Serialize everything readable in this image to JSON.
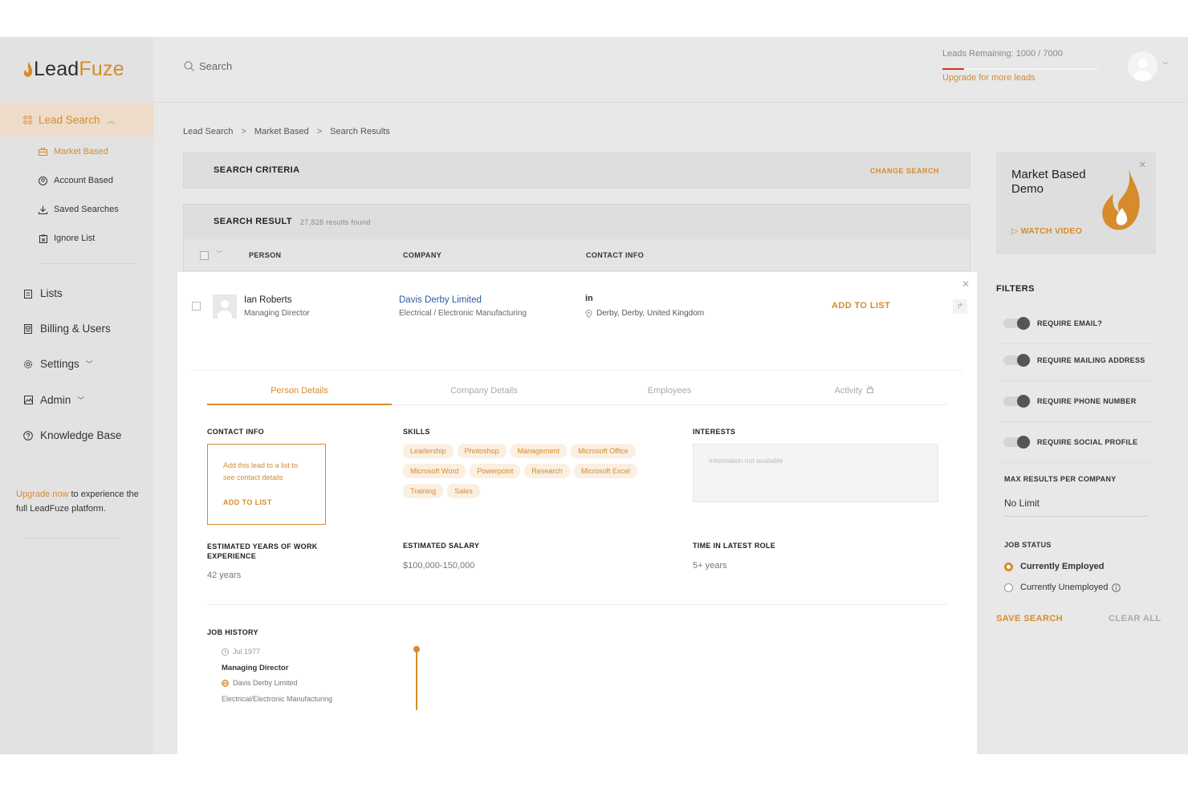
{
  "brand": {
    "lead": "Lead",
    "fuze": "Fuze",
    "accent": "#d68b2c"
  },
  "sidebar": {
    "section": {
      "label": "Lead Search",
      "icon": "grid-icon"
    },
    "subitems": [
      {
        "label": "Market Based",
        "icon": "briefcase-icon",
        "active": true
      },
      {
        "label": "Account Based",
        "icon": "user-circle-icon"
      },
      {
        "label": "Saved Searches",
        "icon": "download-icon"
      },
      {
        "label": "Ignore List",
        "icon": "clipboard-x-icon"
      }
    ],
    "items": [
      {
        "label": "Lists",
        "icon": "clipboard-icon"
      },
      {
        "label": "Billing & Users",
        "icon": "receipt-icon"
      },
      {
        "label": "Settings",
        "icon": "gear-icon"
      },
      {
        "label": "Admin",
        "icon": "image-icon"
      },
      {
        "label": "Knowledge Base",
        "icon": "question-icon"
      }
    ],
    "upgrade": {
      "link": "Upgrade now",
      "rest": " to experience the full LeadFuze platform."
    }
  },
  "header": {
    "search_placeholder": "Search",
    "leads_remaining": "Leads Remaining: 1000 / 7000",
    "leads_fraction": 0.14,
    "upgrade_link": "Upgrade for more leads"
  },
  "breadcrumb": [
    "Lead Search",
    ">",
    "Market Based",
    ">",
    "Search Results"
  ],
  "criteria": {
    "title": "SEARCH CRITERIA",
    "change": "CHANGE SEARCH"
  },
  "results": {
    "title": "SEARCH RESULT",
    "count": "27,828 results found",
    "columns": [
      "PERSON",
      "COMPANY",
      "CONTACT INFO"
    ]
  },
  "lead": {
    "name": "Ian Roberts",
    "title": "Managing Director",
    "company": "Davis Derby Limited",
    "industry": "Electrical / Electronic Manufacturing",
    "linkedin": "in",
    "location": "Derby, Derby, United Kingdom",
    "add_to_list": "ADD TO LIST",
    "tabs": [
      "Person Details",
      "Company Details",
      "Employees",
      "Activity"
    ],
    "contact_info": {
      "label": "CONTACT INFO",
      "message": "Add this lead to a list to see contact details",
      "button": "ADD TO LIST"
    },
    "skills_label": "SKILLS",
    "skills": [
      "Leadership",
      "Photoshop",
      "Management",
      "Microsoft Office",
      "Microsoft Word",
      "Powerpoint",
      "Research",
      "Microsoft Excel",
      "Training",
      "Sales"
    ],
    "interests_label": "INTERESTS",
    "interests_empty": "Information not available",
    "years_label": "ESTIMATED YEARS OF WORK EXPERIENCE",
    "years_value": "42 years",
    "salary_label": "ESTIMATED SALARY",
    "salary_value": "$100,000-150,000",
    "role_time_label": "TIME IN LATEST ROLE",
    "role_time_value": "5+ years",
    "job_history_label": "JOB HISTORY",
    "job_history": [
      {
        "date": "Jul 1977",
        "role": "Managing Director",
        "company": "Davis Derby Limited",
        "industry": "Electrical/Electronic Manufacturing"
      }
    ]
  },
  "demo": {
    "title": "Market Based Demo",
    "watch": "WATCH VIDEO"
  },
  "filters": {
    "title": "FILTERS",
    "toggles": [
      "REQUIRE EMAIL?",
      "REQUIRE MAILING ADDRESS",
      "REQUIRE PHONE NUMBER",
      "REQUIRE SOCIAL PROFILE"
    ],
    "max_results_label": "MAX RESULTS PER COMPANY",
    "max_results_value": "No Limit",
    "job_status_label": "JOB STATUS",
    "job_status_options": [
      "Currently Employed",
      "Currently Unemployed"
    ],
    "job_status_selected": "Currently Employed",
    "save": "SAVE SEARCH",
    "clear": "CLEAR ALL"
  }
}
